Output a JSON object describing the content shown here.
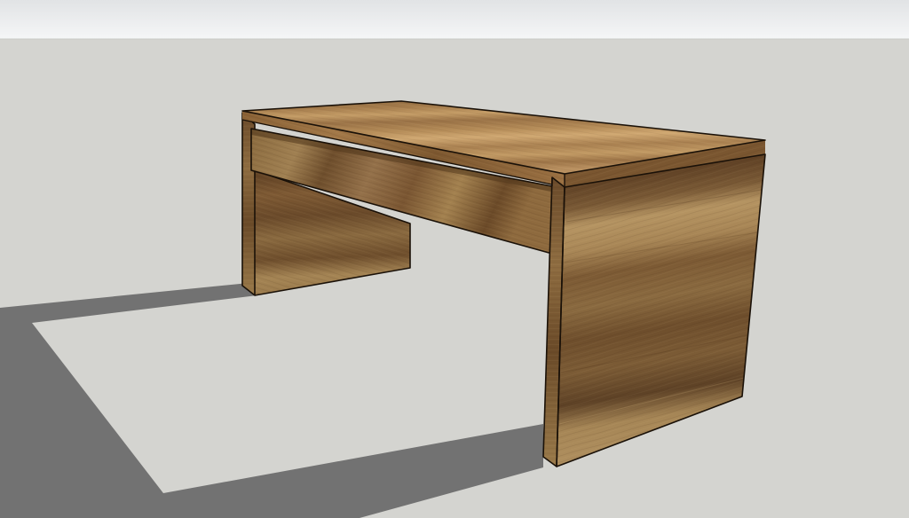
{
  "scene": {
    "subject": "wooden-desk-3d-model",
    "colors": {
      "sky_top": "#e3e5e7",
      "sky_bottom": "#f4f5f6",
      "ground": "#d4d4d0",
      "shadow": "#727272",
      "edge": "#1a1108",
      "wood_light": "#b48a52",
      "wood_mid": "#8a6438",
      "wood_dark": "#5c3f22"
    }
  }
}
